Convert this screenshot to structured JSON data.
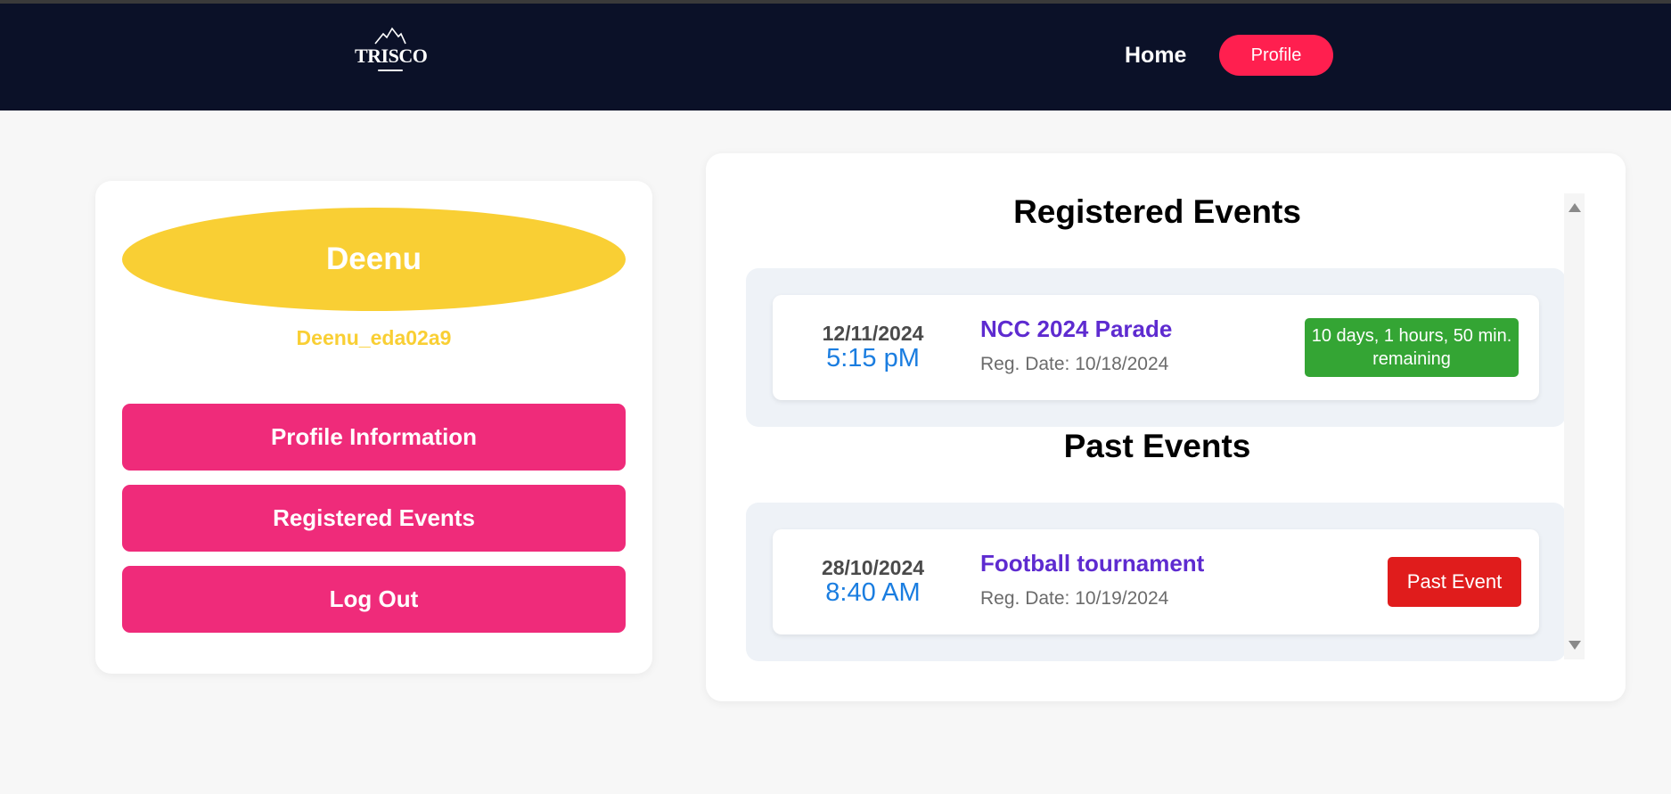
{
  "navbar": {
    "logo_text": "TRISCO",
    "home_label": "Home",
    "profile_label": "Profile"
  },
  "sidebar": {
    "display_name": "Deenu",
    "username": "Deenu_eda02a9",
    "menu": [
      {
        "label": "Profile Information"
      },
      {
        "label": "Registered Events"
      },
      {
        "label": "Log Out"
      }
    ]
  },
  "registered": {
    "title": "Registered Events",
    "events": [
      {
        "date": "12/11/2024",
        "time": "5:15 pM",
        "name": "NCC 2024 Parade",
        "reg_date": "Reg. Date: 10/18/2024",
        "status": "10 days, 1 hours, 50 min. remaining"
      }
    ]
  },
  "past": {
    "title": "Past Events",
    "events": [
      {
        "date": "28/10/2024",
        "time": "8:40 AM",
        "name": "Football tournament",
        "reg_date": "Reg. Date: 10/19/2024",
        "status": "Past Event"
      }
    ]
  },
  "colors": {
    "navbar": "#0b1128",
    "accent_red": "#ff1f4f",
    "menu_pink": "#ef2b7a",
    "avatar_yellow": "#f9cf34",
    "event_purple": "#5e2bd0",
    "time_blue": "#1a7de0",
    "status_green": "#34a534",
    "status_red": "#e01c1c"
  }
}
